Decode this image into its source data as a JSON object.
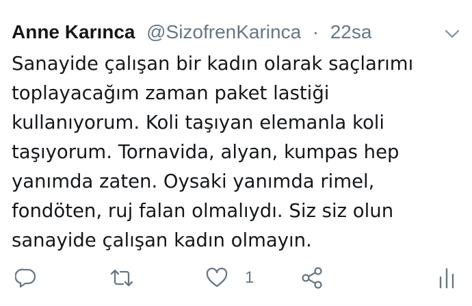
{
  "tweet": {
    "author_name": "Anne Karınca",
    "author_handle": "@SizofrenKarinca",
    "separator": "·",
    "timestamp": "22sa",
    "text_lines": [
      "Sanayide çalışan bir kadın olarak saçlarımı",
      "toplayacağım zaman paket lastiği",
      "kullanıyorum. Koli taşıyan elemanla koli",
      "taşıyorum. Tornavida, alyan, kumpas hep",
      "yanımda zaten. Oysaki yanımda  rimel,",
      "fondöten, ruj falan olmalıydı. Siz siz olun",
      "sanayide çalışan kadın olmayın."
    ],
    "actions": {
      "reply_icon": "reply-icon",
      "retweet_icon": "retweet-icon",
      "like_icon": "heart-icon",
      "like_count": "1",
      "share_icon": "share-icon",
      "analytics_icon": "analytics-icon"
    },
    "colors": {
      "text": "#14171a",
      "secondary": "#657786",
      "background": "#ffffff"
    }
  }
}
